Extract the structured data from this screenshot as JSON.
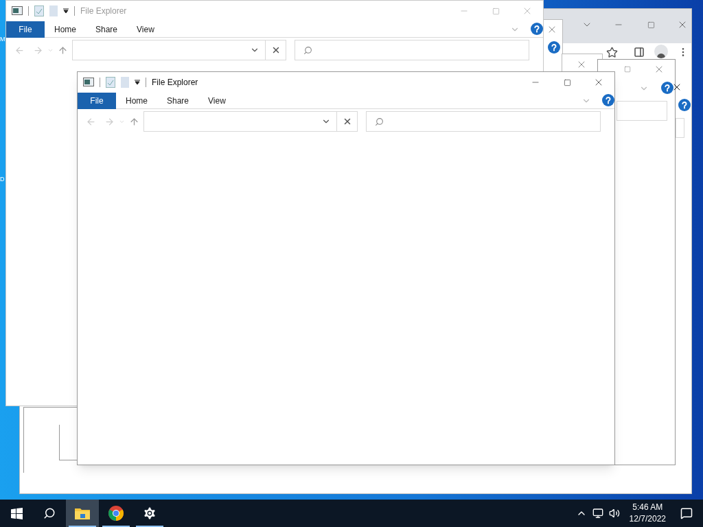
{
  "desktop_labels": [
    "M",
    "D"
  ],
  "browser_window": {
    "active": false
  },
  "explorer_windows": [
    {
      "title": "File Explorer",
      "active": false,
      "tabs": [
        {
          "label": "File",
          "selected": true
        },
        {
          "label": "Home",
          "selected": false
        },
        {
          "label": "Share",
          "selected": false
        },
        {
          "label": "View",
          "selected": false
        }
      ]
    },
    {
      "title": "File Explorer",
      "active": true,
      "tabs": [
        {
          "label": "File",
          "selected": true
        },
        {
          "label": "Home",
          "selected": false
        },
        {
          "label": "Share",
          "selected": false
        },
        {
          "label": "View",
          "selected": false
        }
      ]
    }
  ],
  "taskbar": {
    "apps": [
      {
        "kind": "explorer",
        "selected": true,
        "running": true
      },
      {
        "kind": "chrome",
        "selected": false,
        "running": true
      },
      {
        "kind": "settings",
        "selected": false,
        "running": true
      }
    ],
    "time": "5:46 AM",
    "date": "12/7/2022"
  }
}
